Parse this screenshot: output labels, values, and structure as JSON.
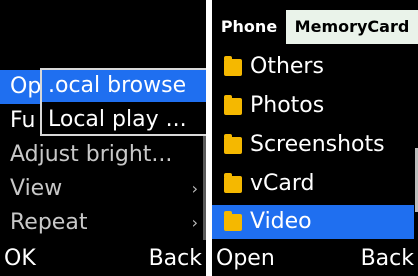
{
  "left": {
    "menu": [
      {
        "label": "Op"
      },
      {
        "label": "Fu"
      },
      {
        "label": "Adjust bright..."
      },
      {
        "label": "View",
        "arrow": "›"
      },
      {
        "label": "Repeat",
        "arrow": "›"
      }
    ],
    "submenu": [
      {
        "label": ".ocal browse"
      },
      {
        "label": "Local play ..."
      }
    ],
    "softkeys": {
      "left": "OK",
      "right": "Back"
    }
  },
  "right": {
    "tabs": {
      "phone": "Phone",
      "memory": "MemoryCard"
    },
    "files": [
      {
        "label": "Others",
        "icon": "folder-icon"
      },
      {
        "label": "Photos",
        "icon": "folder-icon"
      },
      {
        "label": "Screenshots",
        "icon": "folder-icon"
      },
      {
        "label": "vCard",
        "icon": "folder-icon"
      },
      {
        "label": "Video",
        "icon": "folder-icon"
      }
    ],
    "softkeys": {
      "left": "Open",
      "right": "Back"
    }
  },
  "colors": {
    "highlight": "#1f6ff0",
    "folder": "#f5b800",
    "background": "#000000"
  }
}
